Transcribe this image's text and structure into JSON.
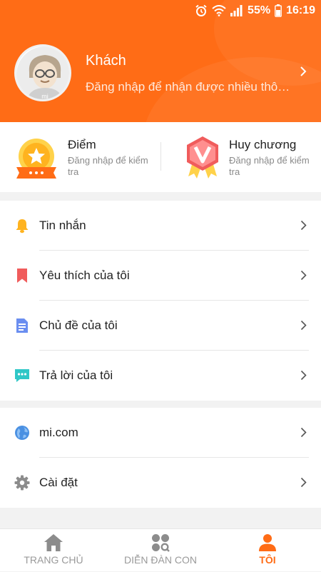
{
  "status_bar": {
    "battery": "55%",
    "time": "16:19"
  },
  "profile": {
    "name": "Khách",
    "hint": "Đăng nhập để nhận được nhiều thông tin hơn",
    "avatar_text": "mi"
  },
  "cards": {
    "points": {
      "title": "Điểm",
      "subtitle": "Đăng nhập để kiểm tra"
    },
    "medals": {
      "title": "Huy chương",
      "subtitle": "Đăng nhập để kiểm tra"
    }
  },
  "menu": {
    "messages": "Tin nhắn",
    "favorites": "Yêu thích của tôi",
    "topics": "Chủ đề của tôi",
    "replies": "Trả lời của tôi",
    "mi_com": "mi.com",
    "settings": "Cài đặt"
  },
  "tabs": {
    "home": "TRANG CHỦ",
    "forums": "DIỄN ĐÀN CON",
    "me": "TÔI"
  },
  "colors": {
    "accent": "#ff6c16",
    "bell": "#ffb31f",
    "bookmark": "#f05c5c",
    "document": "#6b8ef0",
    "chat": "#2fc7c7",
    "globe": "#4a90e2",
    "gear": "#8c8c8c"
  }
}
